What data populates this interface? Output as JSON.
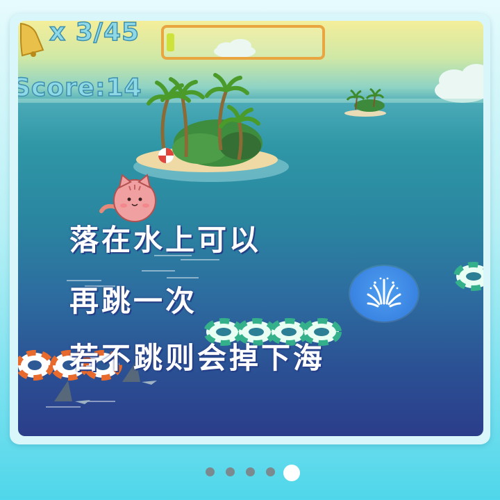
{
  "hud": {
    "lives_count": "x 3/45",
    "score": "Score:14",
    "progress_fraction": 0.05
  },
  "overlay": {
    "line1": "落在水上可以",
    "line2": "再跳一次",
    "line3": "若不跳则会掉下海"
  },
  "controls": {
    "jump_button_icon": "splash-icon"
  },
  "pagination": {
    "count": 5,
    "active_index": 4
  },
  "colors": {
    "sea_top": "#2f97a6",
    "sea_bottom": "#2b3d8a",
    "progress_border": "#e9a640",
    "progress_fill": "#cde23a",
    "jump_button": "#3a84e2",
    "frame": "#4fd6ea"
  }
}
